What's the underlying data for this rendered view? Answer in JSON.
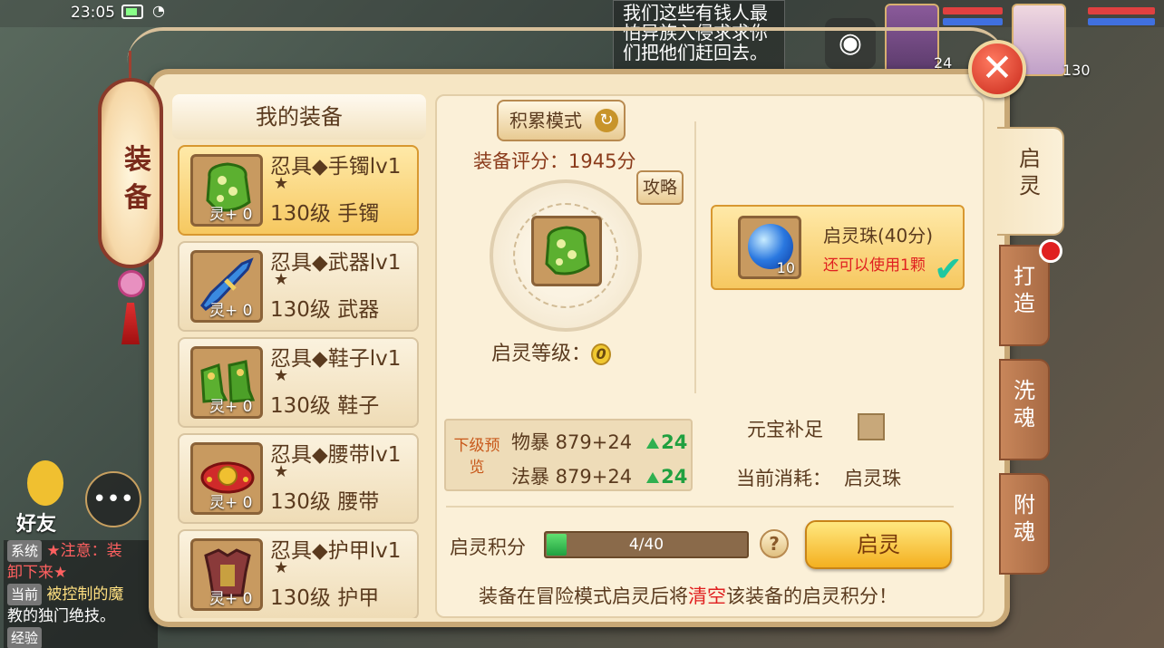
{
  "status": {
    "time": "23:05"
  },
  "quest_text": "我们这些有钱人最怕异族入侵求求你们把他们赶回去。",
  "avatars": [
    {
      "level": "24"
    },
    {
      "level": "130"
    }
  ],
  "friend_label": "好友",
  "chat": {
    "lines": [
      {
        "tag": "系统",
        "text": "★注意：装"
      },
      {
        "tag": "",
        "text": "卸下来★"
      },
      {
        "tag": "当前",
        "text": "被控制的魔"
      },
      {
        "tag": "",
        "text": "教的独门绝技。"
      },
      {
        "tag": "经验",
        "text": ""
      }
    ]
  },
  "side_lantern": {
    "title_1": "装",
    "title_2": "备"
  },
  "equipment_list": {
    "header": "我的装备",
    "items": [
      {
        "name": "忍具◆手镯lv1",
        "star": "★",
        "level": "130级 手镯",
        "soul": "灵+ 0",
        "icon": "bracelet-icon",
        "selected": true
      },
      {
        "name": "忍具◆武器lv1",
        "star": "★",
        "level": "130级 武器",
        "soul": "灵+ 0",
        "icon": "weapon-icon",
        "selected": false
      },
      {
        "name": "忍具◆鞋子lv1",
        "star": "★",
        "level": "130级 鞋子",
        "soul": "灵+ 0",
        "icon": "boots-icon",
        "selected": false
      },
      {
        "name": "忍具◆腰带lv1",
        "star": "★",
        "level": "130级 腰带",
        "soul": "灵+ 0",
        "icon": "belt-icon",
        "selected": false
      },
      {
        "name": "忍具◆护甲lv1",
        "star": "★",
        "level": "130级 护甲",
        "soul": "灵+ 0",
        "icon": "armor-icon",
        "selected": false
      }
    ]
  },
  "main": {
    "mode_button": "积累模式",
    "score_text": "装备评分：1945分",
    "guide_button": "攻略",
    "enhance_level_label": "启灵等级：",
    "enhance_level_value": "0",
    "preview": {
      "label": "下级预览",
      "rows": [
        {
          "stat": "物暴 879+24",
          "gain": "24"
        },
        {
          "stat": "法暴 879+24",
          "gain": "24"
        }
      ]
    },
    "pearl": {
      "name": "启灵珠(40分)",
      "remaining": "还可以使用1颗",
      "count": "10"
    },
    "ingot_label": "元宝补足",
    "cost_label": "当前消耗：",
    "cost_value": "启灵珠",
    "progress_label": "启灵积分",
    "progress_text": "4/40",
    "progress_fraction": 0.1,
    "help_button": "?",
    "enhance_button": "启灵",
    "warning_prefix": "装备在冒险模式启灵后将",
    "warning_red": "清空",
    "warning_suffix": "该装备的启灵积分！"
  },
  "tabs": [
    {
      "label_1": "启",
      "label_2": "灵",
      "active": true
    },
    {
      "label_1": "打",
      "label_2": "造",
      "active": false
    },
    {
      "label_1": "洗",
      "label_2": "魂",
      "active": false
    },
    {
      "label_1": "附",
      "label_2": "魂",
      "active": false
    }
  ],
  "colors": {
    "panel_bg": "#f6e6c4",
    "selected_item": "#f6c860",
    "warning_red": "#e02020",
    "progress_green": "#20a040"
  }
}
